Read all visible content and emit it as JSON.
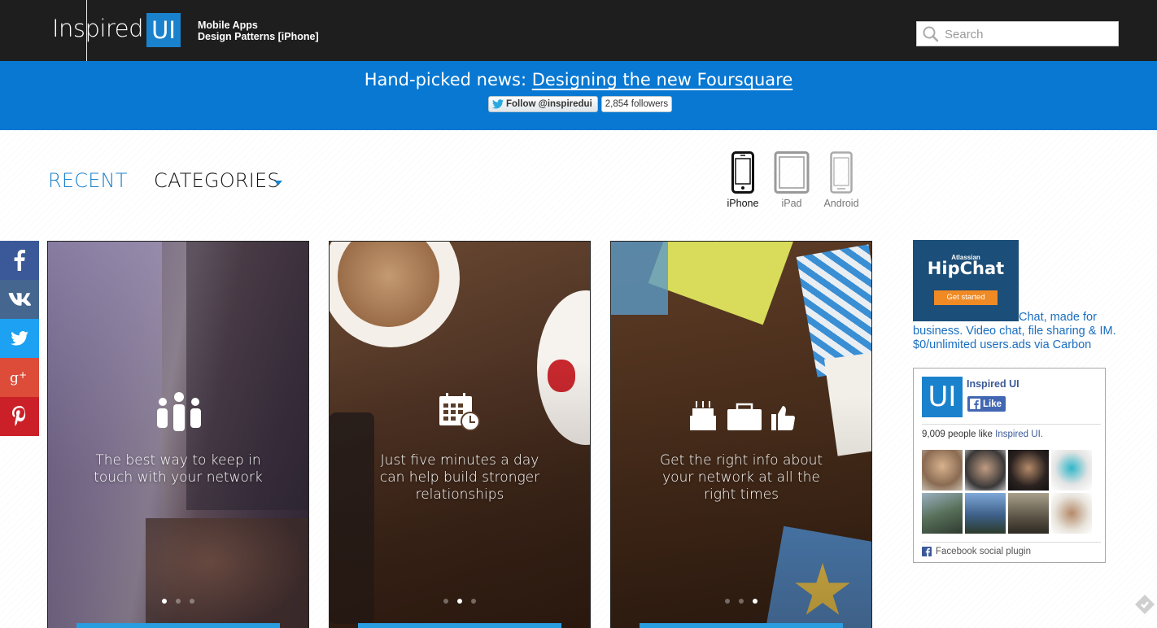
{
  "header": {
    "logo_text": "Inspired",
    "logo_box": "UI",
    "tagline_line1": "Mobile Apps",
    "tagline_line2": "Design Patterns [iPhone]",
    "search_placeholder": "Search",
    "search_icon": "search-icon"
  },
  "news": {
    "prefix": "Hand-picked news: ",
    "link": "Designing the new Foursquare",
    "follow_label": "Follow @inspiredui",
    "followers": "2,854 followers"
  },
  "nav": {
    "recent": "RECENT",
    "categories": "CATEGORIES",
    "accent": "#1a82cc"
  },
  "devices": [
    {
      "label": "iPhone",
      "active": true
    },
    {
      "label": "iPad",
      "active": false
    },
    {
      "label": "Android",
      "active": false
    }
  ],
  "share": [
    {
      "name": "facebook",
      "color": "#3b5998",
      "glyph": "f"
    },
    {
      "name": "vk",
      "color": "#45668e",
      "glyph": "vk"
    },
    {
      "name": "twitter",
      "color": "#1da1f2",
      "glyph": "t"
    },
    {
      "name": "google-plus",
      "color": "#dd4b39",
      "glyph": "g+"
    },
    {
      "name": "pinterest",
      "color": "#cb2027",
      "glyph": "p"
    }
  ],
  "cards": [
    {
      "caption_line1": "The best way to keep in",
      "caption_line2": "touch with your network",
      "caption_line3": "",
      "active_dot": 0
    },
    {
      "caption_line1": "Just five minutes a day",
      "caption_line2": "can help build stronger",
      "caption_line3": "relationships",
      "active_dot": 1
    },
    {
      "caption_line1": "Get the right info about",
      "caption_line2": "your network at all the",
      "caption_line3": "right times",
      "active_dot": 2
    }
  ],
  "ad": {
    "brand_small": "Atlassian",
    "brand": "HipChat",
    "cta": "Get started",
    "text": "Chat, made for business. Video chat, file sharing & IM. $0/unlimited users.ads via Carbon"
  },
  "facebook_box": {
    "logo": "UI",
    "page_name": "Inspired UI",
    "like_label": "Like",
    "count_prefix": "9,009 people like ",
    "count_link": "Inspired UI.",
    "plugin_label": "Facebook social plugin",
    "brand_color": "#3b5998"
  }
}
